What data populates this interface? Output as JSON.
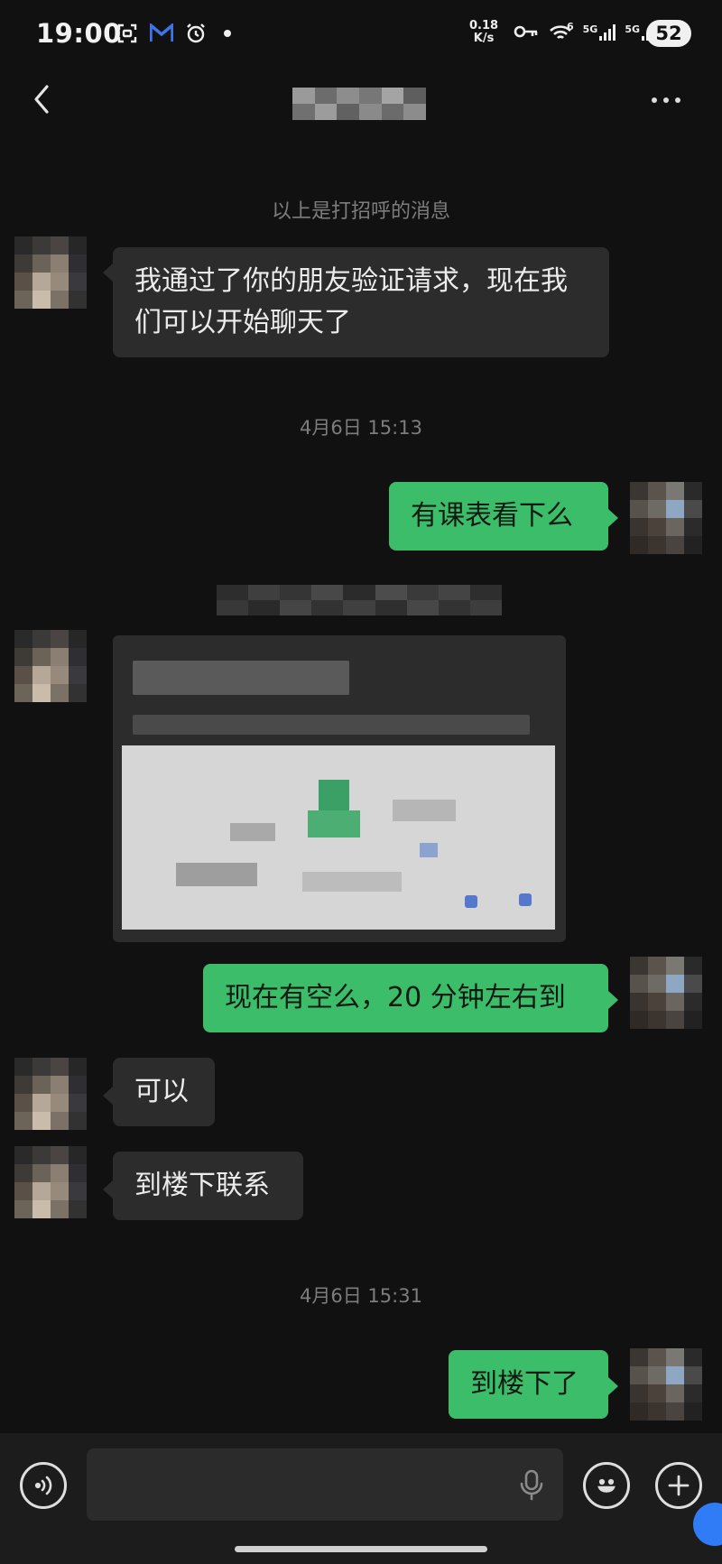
{
  "status_bar": {
    "time": "19:00",
    "net_speed_value": "0.18",
    "net_speed_unit": "K/s",
    "wifi_badge": "6",
    "sim1": "5G",
    "sim2": "5G",
    "battery": "52",
    "icons": [
      "scan-icon",
      "mail-app-icon",
      "alarm-icon",
      "dot-icon",
      "key-icon",
      "wifi-icon",
      "signal-icon",
      "signal-icon"
    ]
  },
  "header": {
    "back_icon": "chevron-left-icon",
    "title": "",
    "more_icon": "more-dots-icon"
  },
  "messages": {
    "greeting_notice": "以上是打招呼的消息",
    "m1": "我通过了你的朋友验证请求，现在我们可以开始聊天了",
    "ts1": "4月6日 15:13",
    "m2": "有课表看下么",
    "m4": "现在有空么，20 分钟左右到",
    "m5": "可以",
    "m6": "到楼下联系",
    "ts2": "4月6日 15:31",
    "m7": "到楼下了"
  },
  "input_bar": {
    "voice_icon": "voice-icon",
    "mic_icon": "mic-icon",
    "emoji_icon": "emoji-icon",
    "plus_icon": "plus-icon"
  },
  "colors": {
    "background": "#111111",
    "incoming_bubble": "#2c2c2c",
    "outgoing_bubble": "#3bbd6a",
    "muted_text": "#7d7d7d"
  }
}
